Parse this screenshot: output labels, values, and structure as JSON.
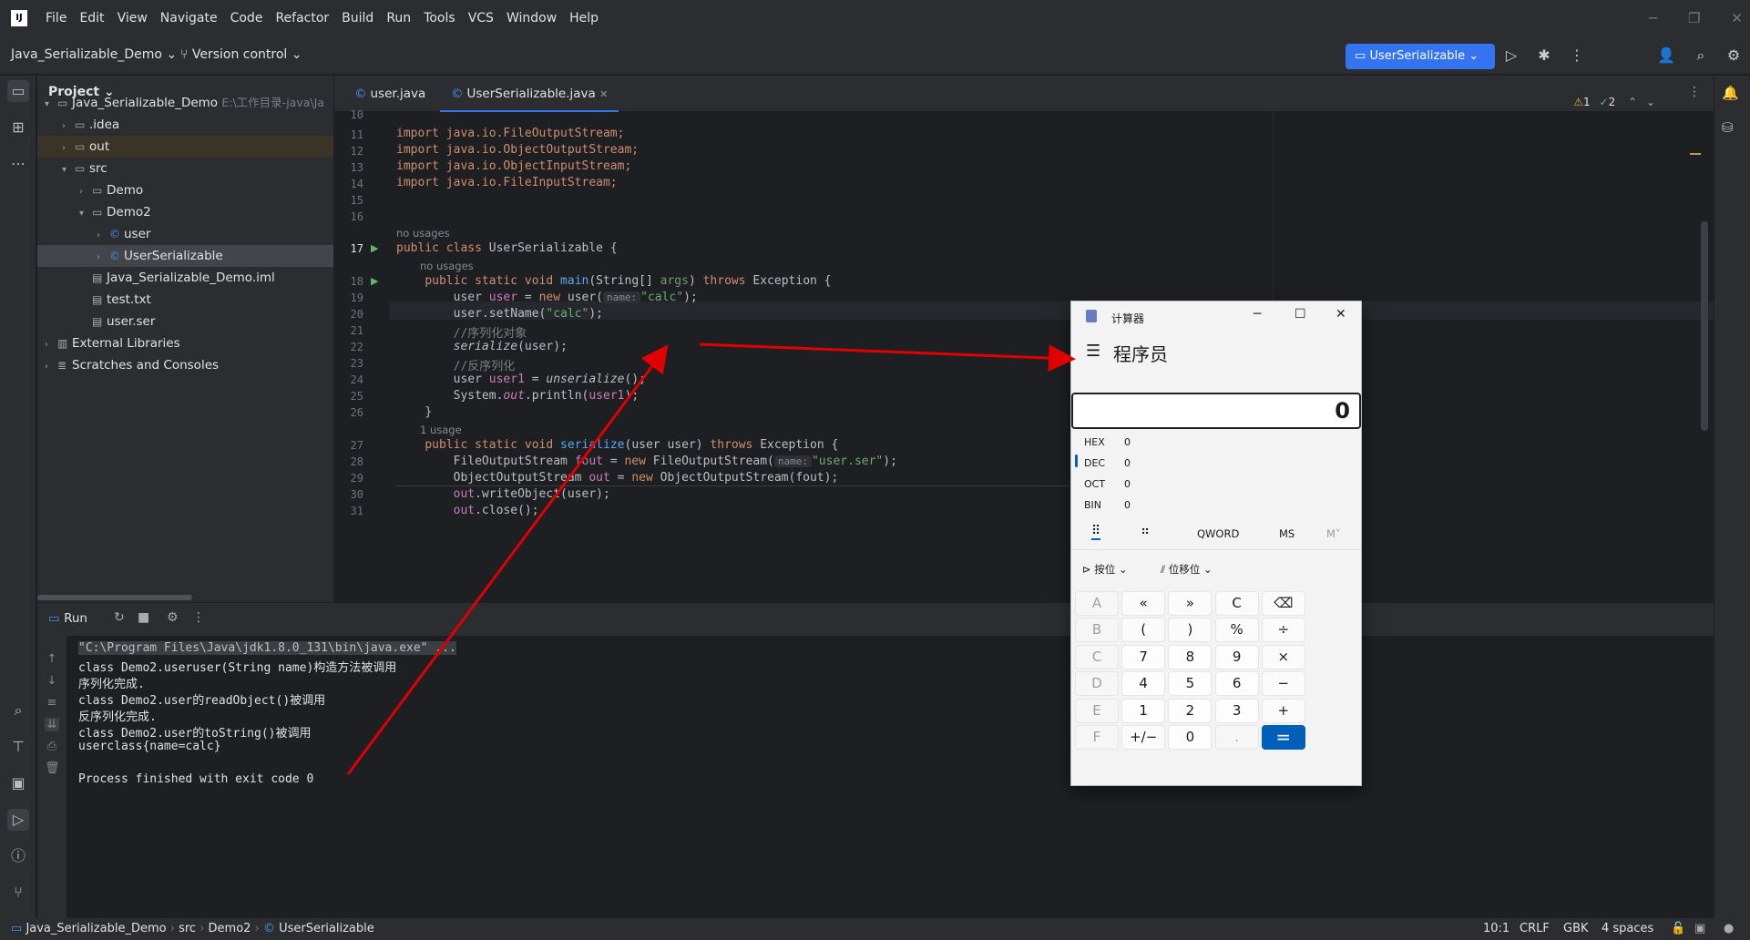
{
  "menu": {
    "logo": "IJ",
    "items": [
      "File",
      "Edit",
      "View",
      "Navigate",
      "Code",
      "Refactor",
      "Build",
      "Run",
      "Tools",
      "VCS",
      "Window",
      "Help"
    ]
  },
  "toolbar": {
    "project": "Java_Serializable_Demo",
    "vcs": "Version control",
    "run_config": "UserSerializable"
  },
  "project": {
    "title": "Project",
    "tree": [
      {
        "label": "Java_Serializable_Demo",
        "path": "E:\\工作目录-java\\Ja",
        "indent": 0,
        "arrow": "v",
        "icon": "folder"
      },
      {
        "label": ".idea",
        "indent": 1,
        "arrow": ">",
        "icon": "folder"
      },
      {
        "label": "out",
        "indent": 1,
        "arrow": ">",
        "icon": "folder",
        "hl": true
      },
      {
        "label": "src",
        "indent": 1,
        "arrow": "v",
        "icon": "folder"
      },
      {
        "label": "Demo",
        "indent": 2,
        "arrow": ">",
        "icon": "folder"
      },
      {
        "label": "Demo2",
        "indent": 2,
        "arrow": "v",
        "icon": "folder"
      },
      {
        "label": "user",
        "indent": 3,
        "arrow": ">",
        "icon": "class"
      },
      {
        "label": "UserSerializable",
        "indent": 3,
        "arrow": ">",
        "icon": "class",
        "sel": true
      },
      {
        "label": "Java_Serializable_Demo.iml",
        "indent": 2,
        "arrow": "",
        "icon": "file"
      },
      {
        "label": "test.txt",
        "indent": 2,
        "arrow": "",
        "icon": "file"
      },
      {
        "label": "user.ser",
        "indent": 2,
        "arrow": "",
        "icon": "file"
      },
      {
        "label": "External Libraries",
        "indent": 0,
        "arrow": ">",
        "icon": "lib"
      },
      {
        "label": "Scratches and Consoles",
        "indent": 0,
        "arrow": ">",
        "icon": "scratch"
      }
    ]
  },
  "tabs": [
    "user.java",
    "UserSerializable.java"
  ],
  "inspection": {
    "warnings": "1",
    "weak": "2"
  },
  "code": {
    "lines": [
      "10",
      "11",
      "12",
      "13",
      "14",
      "15",
      "16",
      "17",
      "18",
      "19",
      "20",
      "21",
      "22",
      "23",
      "24",
      "25",
      "26",
      "27",
      "28",
      "29",
      "30",
      "31"
    ],
    "hints": {
      "no_usages": "no usages",
      "one_usage": "1 usage",
      "name": "name:"
    },
    "l11": "import java.io.FileOutputStream;",
    "l12": "import java.io.ObjectOutputStream;",
    "l13": "import java.io.ObjectInputStream;",
    "l14": "import java.io.FileInputStream;",
    "kw_public": "public",
    "kw_class": "class",
    "cls_name": "UserSerializable",
    "brace": "{",
    "kw_static": "static",
    "kw_void": "void",
    "fn_main": "main",
    "main_params": "(String[] ",
    "args": "args",
    "throws": "throws",
    "exc": "Exception {",
    "l19a": "user ",
    "l19b": "user",
    "l19c": " = ",
    "kw_new": "new",
    "l19d": " user(",
    "str_calc": "\"calc\"",
    "l19e": ");",
    "l20a": "user.setName(",
    "l20c": ");",
    "c21": "//序列化对象",
    "l22a": "serialize",
    "l22b": "(user);",
    "c23": "//反序列化",
    "l24a": "user ",
    "l24b": "user1",
    "l24c": " = ",
    "l24d": "unserialize",
    "l24e": "();",
    "l25a": "System.",
    "l25b": "out",
    "l25c": ".println(",
    "l25d": "user1",
    "l25e": ");",
    "close": "}",
    "fn_serialize": "serialize",
    "ser_params": "(user user) ",
    "l28a": "FileOutputStream ",
    "l28b": "fout",
    "l28c": " = ",
    "l28d": " FileOutputStream(",
    "str_ser": "\"user.ser\"",
    "l28e": ");",
    "l29a": "ObjectOutputStream ",
    "l29b": "out",
    "l29c": " = ",
    "l29d": " ObjectOutputStream(fout);",
    "l30a": "out",
    "l30b": ".writeObject(user);",
    "l31a": "out",
    "l31b": ".close();"
  },
  "run": {
    "title": "Run",
    "output": [
      "\"C:\\Program Files\\Java\\jdk1.8.0_131\\bin\\java.exe\" ...",
      "class Demo2.useruser(String name)构造方法被调用",
      "序列化完成.",
      "class Demo2.user的readObject()被调用",
      "反序列化完成.",
      "class Demo2.user的toString()被调用",
      "userclass{name=calc}",
      "",
      "Process finished with exit code 0"
    ]
  },
  "status": {
    "breadcrumbs": [
      "Java_Serializable_Demo",
      "src",
      "Demo2",
      "UserSerializable"
    ],
    "position": "10:1",
    "line_sep": "CRLF",
    "encoding": "GBK",
    "indent": "4 spaces"
  },
  "calculator": {
    "title": "计算器",
    "mode": "程序员",
    "display": "0",
    "bases": [
      {
        "name": "HEX",
        "value": "0"
      },
      {
        "name": "DEC",
        "value": "0"
      },
      {
        "name": "OCT",
        "value": "0"
      },
      {
        "name": "BIN",
        "value": "0"
      }
    ],
    "word_size": "QWORD",
    "ms": "MS",
    "mplus": "M˅",
    "bitwise": "按位",
    "bitshift": "位移位",
    "keys": [
      [
        "A",
        "«",
        "»",
        "C",
        "⌫"
      ],
      [
        "B",
        "(",
        ")",
        "%",
        "÷"
      ],
      [
        "C",
        "7",
        "8",
        "9",
        "×"
      ],
      [
        "D",
        "4",
        "5",
        "6",
        "−"
      ],
      [
        "E",
        "1",
        "2",
        "3",
        "+"
      ],
      [
        "F",
        "+/−",
        "0",
        ".",
        "="
      ]
    ]
  },
  "colors": {
    "accent": "#3574f0",
    "arrow": "#e00000",
    "calc_equals": "#005fb8"
  }
}
